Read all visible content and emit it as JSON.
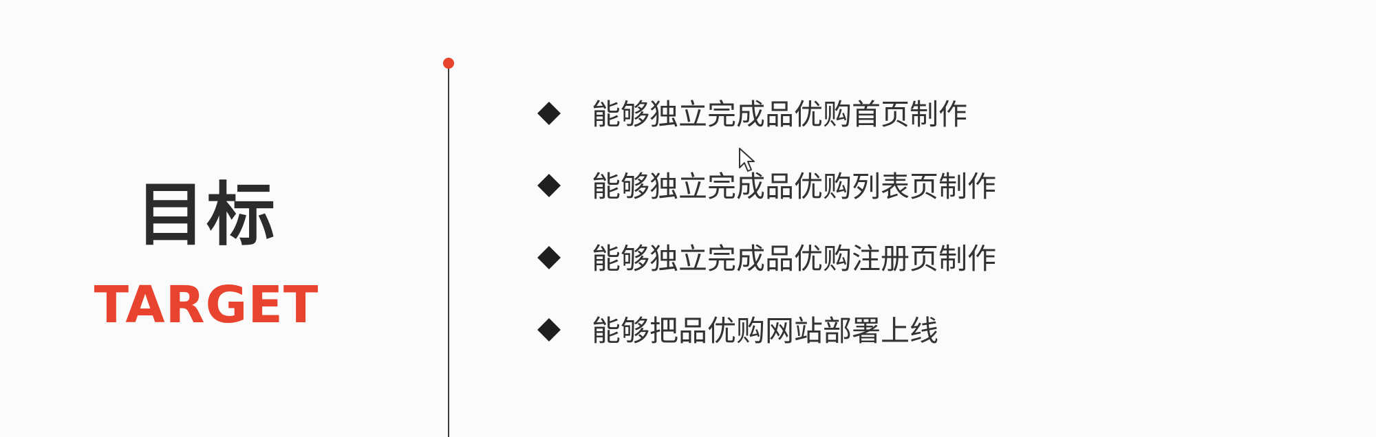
{
  "title": {
    "chinese": "目标",
    "english": "TARGET"
  },
  "goals": [
    "能够独立完成品优购首页制作",
    "能够独立完成品优购列表页制作",
    "能够独立完成品优购注册页制作",
    "能够把品优购网站部署上线"
  ],
  "colors": {
    "accent": "#e8432e",
    "text": "#333333",
    "heading": "#2b2b2b",
    "background": "#fbfbfb"
  },
  "icons": {
    "bullet": "diamond-bullet-icon",
    "cursor": "mouse-pointer-icon"
  }
}
